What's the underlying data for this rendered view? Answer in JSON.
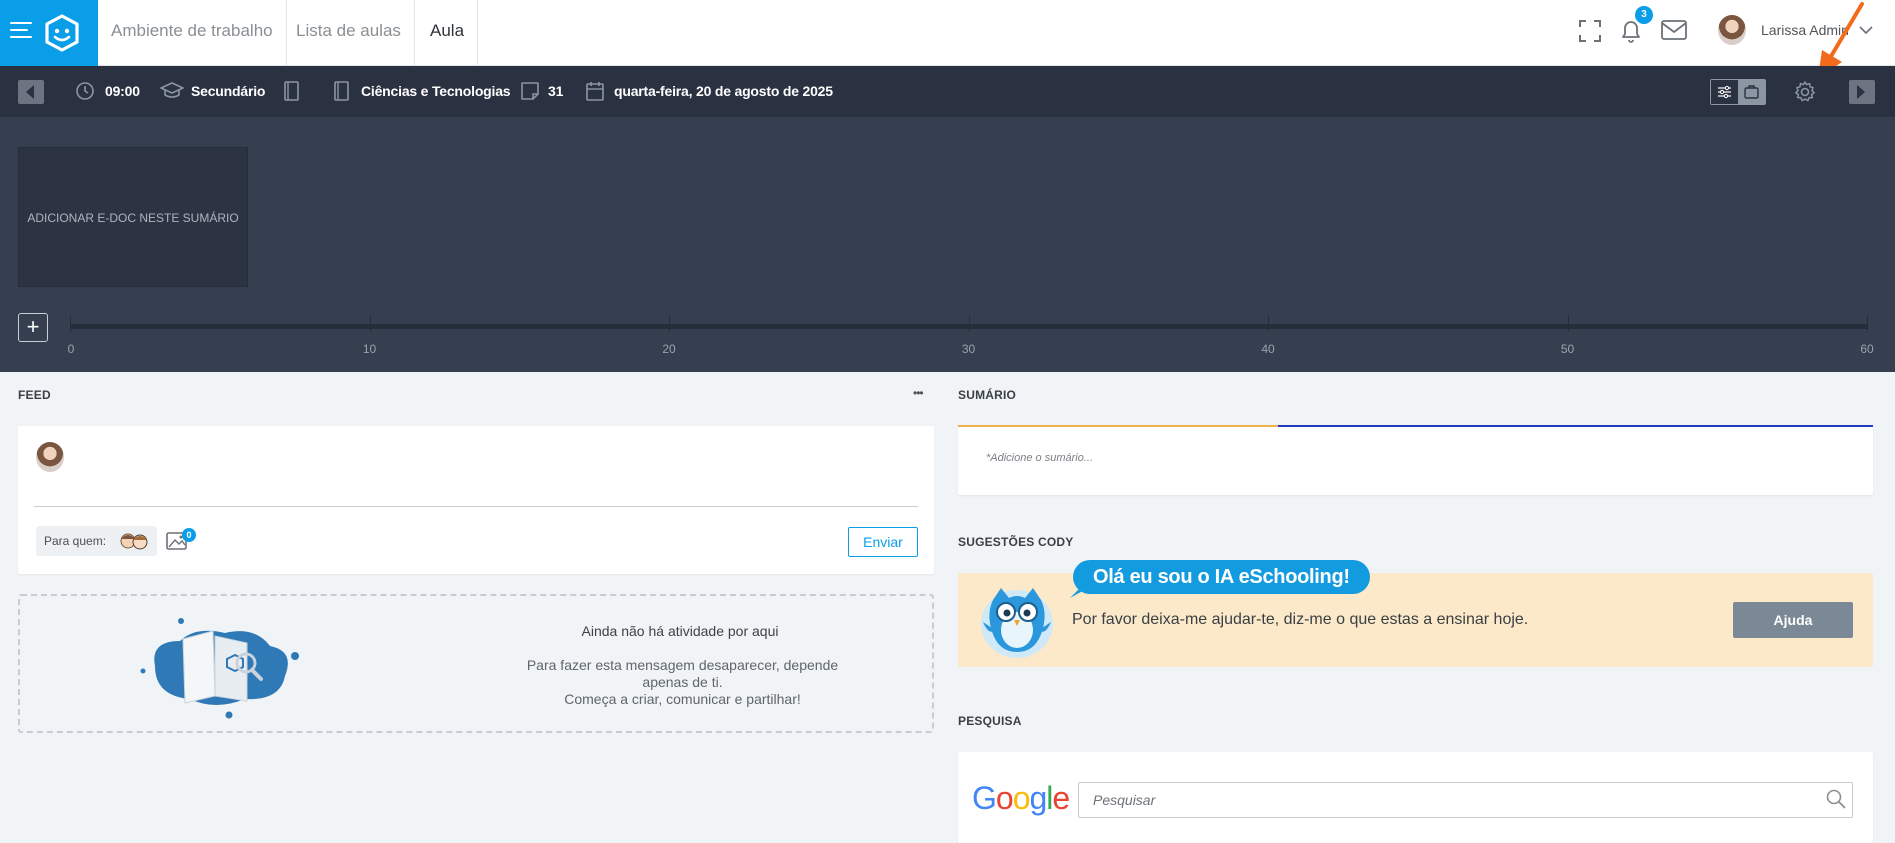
{
  "nav": {
    "tabs": [
      {
        "label": "Ambiente de trabalho"
      },
      {
        "label": "Lista de aulas"
      },
      {
        "label": "Aula"
      }
    ],
    "notifications_count": "3",
    "user_name": "Larissa Admin"
  },
  "toolbar": {
    "time": "09:00",
    "level": "Secundário",
    "subject": "Ciências e Tecnologias",
    "lesson_number": "31",
    "date": "quarta-feira, 20 de agosto de 2025"
  },
  "timeline": {
    "add_edoc_label": "ADICIONAR E-DOC NESTE SUMÁRIO",
    "plus_label": "+",
    "ticks": [
      "0",
      "10",
      "20",
      "30",
      "40",
      "50",
      "60"
    ]
  },
  "feed": {
    "title": "FEED",
    "more_label": "•••",
    "para_quem_label": "Para quem:",
    "media_count": "0",
    "send_label": "Enviar",
    "empty_title": "Ainda não há atividade por aqui",
    "empty_text_1": "Para fazer esta mensagem desaparecer, depende apenas de ti.",
    "empty_text_2": "Começa a criar, comunicar e partilhar!"
  },
  "sumario": {
    "title": "SUMÁRIO",
    "placeholder": "*Adicione o sumário..."
  },
  "cody": {
    "title": "SUGESTÕES CODY",
    "bubble": "Olá eu sou o IA eSchooling!",
    "text": "Por favor deixa-me ajudar-te, diz-me o que estas a ensinar hoje.",
    "help_label": "Ajuda"
  },
  "pesquisa": {
    "title": "PESQUISA",
    "google_letters": [
      "G",
      "o",
      "o",
      "g",
      "l",
      "e"
    ],
    "placeholder": "Pesquisar"
  },
  "colors": {
    "brand_blue": "#0a9ee8",
    "toolbar_bg": "#2a3140",
    "timeline_bg": "#363f50",
    "annotation_arrow": "#f26a1b"
  }
}
